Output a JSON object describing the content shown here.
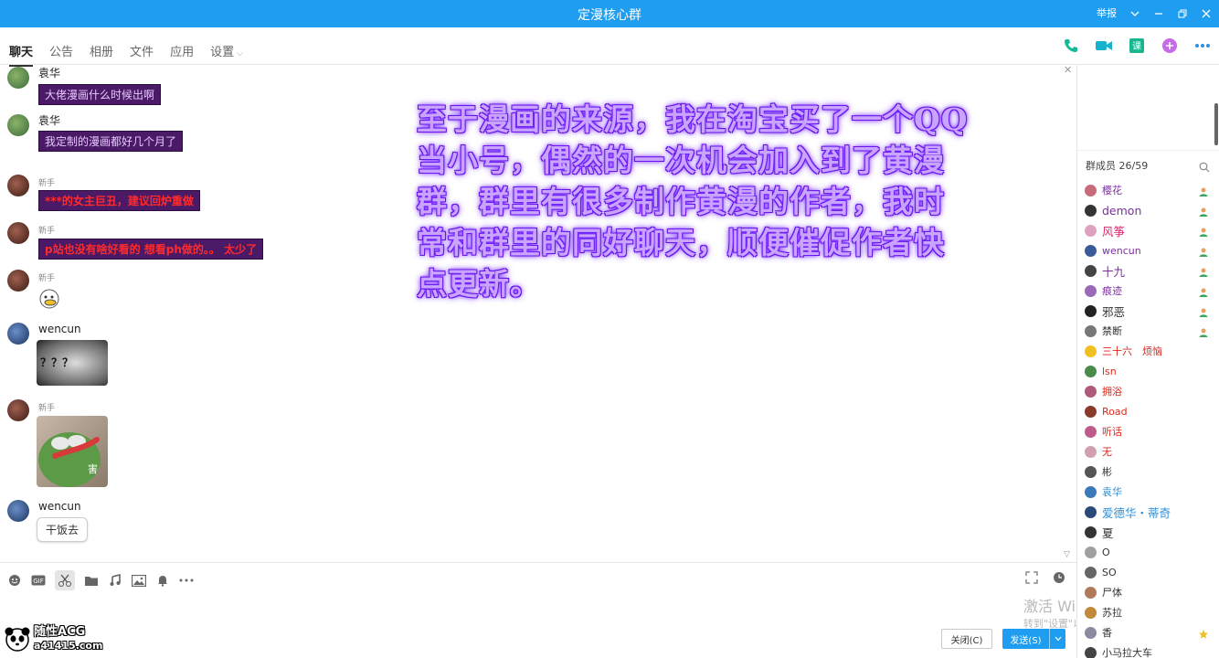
{
  "titlebar": {
    "title": "定漫核心群",
    "report": "举报"
  },
  "tabs": [
    {
      "label": "聊天",
      "active": true
    },
    {
      "label": "公告",
      "active": false
    },
    {
      "label": "相册",
      "active": false
    },
    {
      "label": "文件",
      "active": false
    },
    {
      "label": "应用",
      "active": false
    },
    {
      "label": "设置",
      "active": false
    }
  ],
  "messages": [
    {
      "sender": "袁华",
      "text": "大佬漫画什么时候出啊"
    },
    {
      "sender": "袁华",
      "text": "我定制的漫画都好几个月了"
    },
    {
      "sender": "新手",
      "text": "***的女主巨丑，建议回炉重做"
    },
    {
      "sender": "新手",
      "text": "p站也没有啥好看的 想看ph做的。。 太少了"
    },
    {
      "sender": "新手"
    },
    {
      "sender": "wencun",
      "image_text": "？？？"
    },
    {
      "sender": "新手",
      "image_text": "害"
    },
    {
      "sender": "wencun",
      "text": "干饭去"
    }
  ],
  "overlay": {
    "lines": [
      "至于漫画的来源，我在淘宝买了一个QQ",
      "当小号，偶然的一次机会加入到了黄漫",
      "群，群里有很多制作黄漫的作者，我时",
      "常和群里的同好聊天，顺便催促作者快",
      "点更新。"
    ]
  },
  "input": {
    "close_label": "关闭(C)",
    "send_label": "发送(S)"
  },
  "watermark": {
    "line1": "激活 Windows",
    "line2": "转到\"设置\"以激活 Windows。"
  },
  "logo": {
    "line1": "随性ACG",
    "line2": "a41415.com"
  },
  "members": {
    "header": "群成员 26/59",
    "list": [
      {
        "name": "樱花",
        "color": "#7a2e9e"
      },
      {
        "name": "demon",
        "color": "#7a2e9e"
      },
      {
        "name": "风筝",
        "color": "#e0266a"
      },
      {
        "name": "wencun",
        "color": "#7a2e9e"
      },
      {
        "name": "十九",
        "color": "#7a2e9e"
      },
      {
        "name": "痕迹",
        "color": "#7a2e9e"
      },
      {
        "name": "邪恶",
        "color": "#333333"
      },
      {
        "name": "禁断",
        "color": "#333333"
      },
      {
        "name": "三十六　烦恼",
        "color": "#e0261a"
      },
      {
        "name": "lsn",
        "color": "#e0261a"
      },
      {
        "name": "拥浴",
        "color": "#e0261a"
      },
      {
        "name": "Road",
        "color": "#e0261a"
      },
      {
        "name": "听话",
        "color": "#e0261a"
      },
      {
        "name": "无",
        "color": "#e0261a"
      },
      {
        "name": "彬",
        "color": "#333333"
      },
      {
        "name": "袁华",
        "color": "#2f8fd8"
      },
      {
        "name": "爱德华・蒂奇",
        "color": "#2f8fd8"
      },
      {
        "name": "夏",
        "color": "#333333"
      },
      {
        "name": "O",
        "color": "#333333"
      },
      {
        "name": "SO",
        "color": "#333333"
      },
      {
        "name": "尸体",
        "color": "#333333"
      },
      {
        "name": "苏拉",
        "color": "#333333"
      },
      {
        "name": "香",
        "color": "#333333"
      },
      {
        "name": "小马拉大车",
        "color": "#333333"
      }
    ]
  },
  "colors": {
    "accent": "#1e9df1",
    "overlay_purple": "#c9a4ff",
    "bubble_bg": "#4a1a66"
  }
}
